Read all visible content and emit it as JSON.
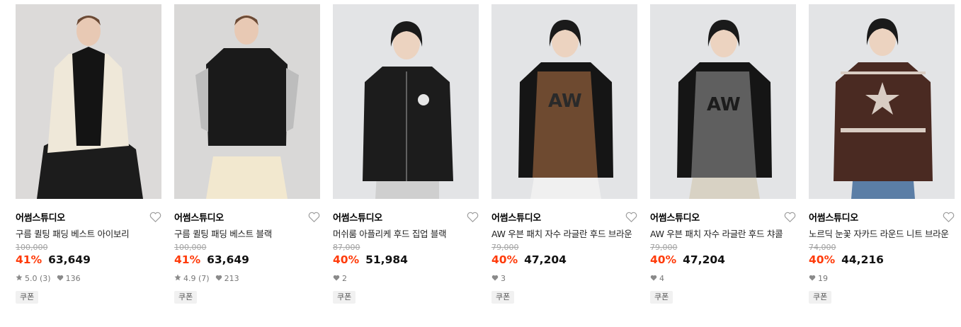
{
  "colors": {
    "discount": "#ff3b0a",
    "image_bg": "#e9e9ea"
  },
  "products": [
    {
      "brand": "어썸스튜디오",
      "title": "구름 퀼팅 패딩 베스트 아이보리",
      "original_price": "100,000",
      "discount": "41%",
      "price": "63,649",
      "rating": "5.0 (3)",
      "likes": "136",
      "coupon": "쿠폰",
      "image": "model wearing ivory cloud quilted padded vest"
    },
    {
      "brand": "어썸스튜디오",
      "title": "구름 퀼팅 패딩 베스트 블랙",
      "original_price": "100,000",
      "discount": "41%",
      "price": "63,649",
      "rating": "4.9 (7)",
      "likes": "213",
      "coupon": "쿠폰",
      "image": "model wearing black quilted padded vest"
    },
    {
      "brand": "어썸스튜디오",
      "title": "머쉬룸 아플리케 후드 집업 블랙",
      "original_price": "87,000",
      "discount": "40%",
      "price": "51,984",
      "likes": "2",
      "coupon": "쿠폰",
      "image": "model wearing black zip-up hoodie"
    },
    {
      "brand": "어썸스튜디오",
      "title": "AW 우븐 패치 자수 라글란 후드 브라운",
      "original_price": "79,000",
      "discount": "40%",
      "price": "47,204",
      "likes": "3",
      "coupon": "쿠폰",
      "image": "model wearing brown raglan hoodie"
    },
    {
      "brand": "어썸스튜디오",
      "title": "AW 우븐 패치 자수 라글란 후드 챠콜",
      "original_price": "79,000",
      "discount": "40%",
      "price": "47,204",
      "likes": "4",
      "coupon": "쿠폰",
      "image": "model wearing charcoal raglan hoodie"
    },
    {
      "brand": "어썸스튜디오",
      "title": "노르딕 눈꽃 자카드 라운드 니트 브라운",
      "original_price": "74,000",
      "discount": "40%",
      "price": "44,216",
      "likes": "19",
      "coupon": "쿠폰",
      "image": "model wearing brown nordic snowflake knit"
    }
  ],
  "icons": {
    "wishlist": "heart-outline-icon",
    "rating": "star-icon",
    "likes": "heart-filled-icon"
  }
}
